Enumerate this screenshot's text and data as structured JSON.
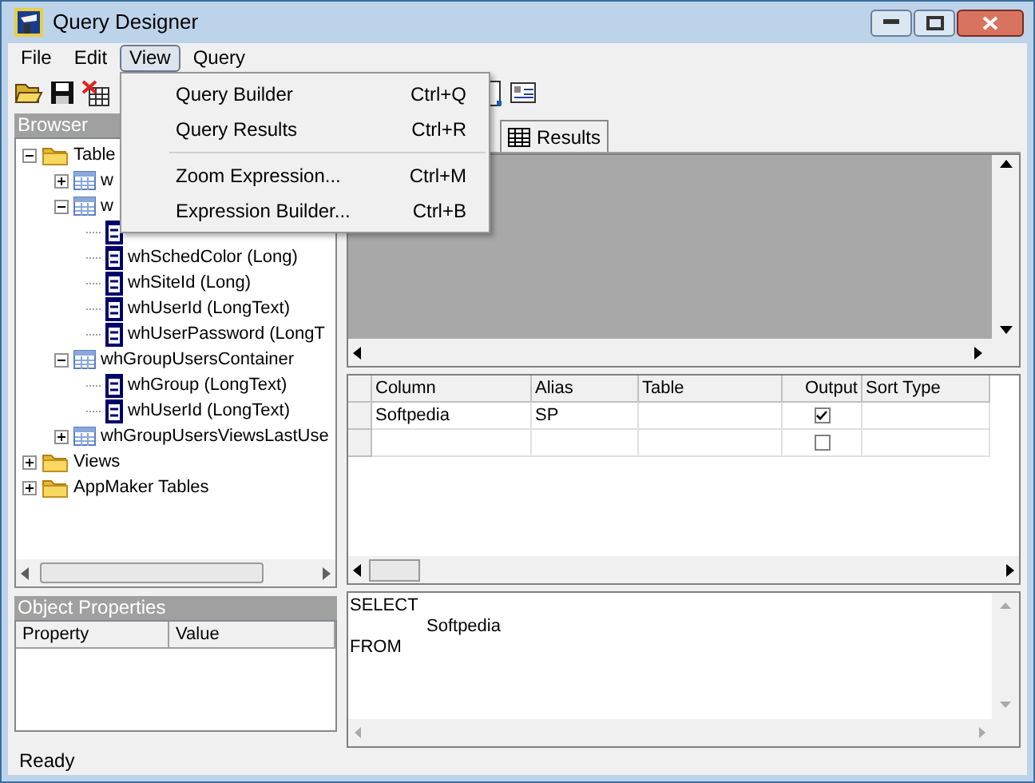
{
  "window": {
    "title": "Query Designer"
  },
  "menu": [
    {
      "label": "File",
      "selected": false
    },
    {
      "label": "Edit",
      "selected": false
    },
    {
      "label": "View",
      "selected": true
    },
    {
      "label": "Query",
      "selected": false
    }
  ],
  "view_menu": {
    "items": [
      {
        "kind": "item",
        "label": "Query Builder",
        "shortcut": "Ctrl+Q"
      },
      {
        "kind": "item",
        "label": "Query Results",
        "shortcut": "Ctrl+R"
      },
      {
        "kind": "separator"
      },
      {
        "kind": "item",
        "label": "Zoom Expression...",
        "shortcut": "Ctrl+M"
      },
      {
        "kind": "item",
        "label": "Expression Builder...",
        "shortcut": "Ctrl+B"
      }
    ]
  },
  "browser": {
    "title": "Browser",
    "tree": [
      {
        "kind": "folder",
        "label": "Table",
        "expanded": true,
        "children": [
          {
            "kind": "table",
            "label": "w",
            "expanded": false
          },
          {
            "kind": "table",
            "label": "w",
            "expanded": true,
            "children": [
              {
                "kind": "field"
              },
              {
                "kind": "field",
                "label": "whSchedColor (Long)"
              },
              {
                "kind": "field",
                "label": "whSiteId (Long)"
              },
              {
                "kind": "field",
                "label": "whUserId (LongText)"
              },
              {
                "kind": "field",
                "label": "whUserPassword (LongT"
              }
            ]
          },
          {
            "kind": "table",
            "label": "whGroupUsersContainer",
            "expanded": true,
            "children": [
              {
                "kind": "field",
                "label": "whGroup (LongText)"
              },
              {
                "kind": "field",
                "label": "whUserId (LongText)"
              }
            ]
          },
          {
            "kind": "table",
            "label": "whGroupUsersViewsLastUse",
            "expanded": false
          }
        ]
      },
      {
        "kind": "folder",
        "label": "Views",
        "expanded": false
      },
      {
        "kind": "folder",
        "label": "AppMaker Tables",
        "expanded": false
      }
    ]
  },
  "object_properties": {
    "title": "Object Properties",
    "columns": [
      "Property",
      "Value"
    ]
  },
  "results_tab": {
    "label": "Results"
  },
  "grid": {
    "columns": [
      "Column",
      "Alias",
      "Table",
      "Output",
      "Sort Type"
    ],
    "rows": [
      {
        "column": "Softpedia",
        "alias": "SP",
        "output": true
      },
      {
        "output": false
      }
    ]
  },
  "sql": {
    "lines": [
      {
        "text": "SELECT",
        "indented": false
      },
      {
        "text": "Softpedia",
        "indented": true
      },
      {
        "text": "FROM",
        "indented": false
      }
    ]
  },
  "status_bar": {
    "text": "Ready"
  }
}
